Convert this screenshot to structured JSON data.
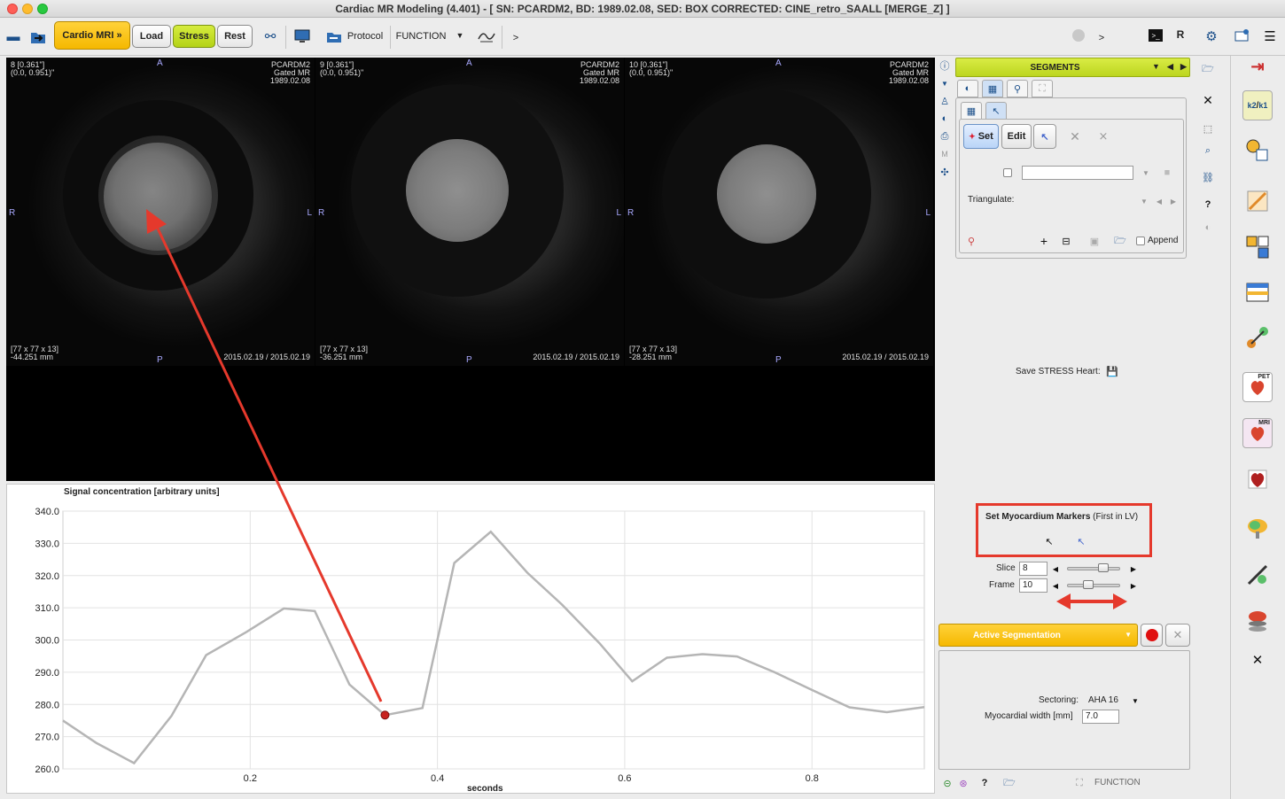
{
  "window": {
    "title": "Cardiac MR Modeling (4.401) - [ SN: PCARDM2, BD: 1989.02.08, SED: BOX CORRECTED: CINE_retro_SAALL  [MERGE_Z] ]"
  },
  "toolbar": {
    "cardio_label": "Cardio MRI »",
    "load_label": "Load",
    "stress_label": "Stress",
    "rest_label": "Rest",
    "protocol_label": "Protocol",
    "function_label": "FUNCTION",
    "more_label": ">",
    "more2_label": ">",
    "r_label": "R"
  },
  "viewports": [
    {
      "slice_info": "8 [0.361\"]\n(0.0, 0.951)\"",
      "patient_info": "PCARDM2\nGated MR\n1989.02.08",
      "dims": "[77 x 77 x 13]\n-44.251 mm",
      "dates": "2015.02.19 / 2015.02.19",
      "orient_a": "A",
      "orient_p": "P",
      "orient_r": "R",
      "orient_l": "L"
    },
    {
      "slice_info": "9 [0.361\"]\n(0.0, 0.951)\"",
      "patient_info": "PCARDM2\nGated MR\n1989.02.08",
      "dims": "[77 x 77 x 13]\n-36.251 mm",
      "dates": "2015.02.19 / 2015.02.19",
      "orient_a": "A",
      "orient_p": "P",
      "orient_r": "R",
      "orient_l": "L"
    },
    {
      "slice_info": "10 [0.361\"]\n(0.0, 0.951)\"",
      "patient_info": "PCARDM2\nGated MR\n1989.02.08",
      "dims": "[77 x 77 x 13]\n-28.251 mm",
      "dates": "2015.02.19 / 2015.02.19",
      "orient_a": "A",
      "orient_p": "P",
      "orient_r": "R",
      "orient_l": "L"
    }
  ],
  "chart_data": {
    "type": "line",
    "ylabel": "Signal concentration [arbitrary units]",
    "xlabel": "seconds",
    "ylim": [
      260.0,
      340.0
    ],
    "xlim": [
      0.0,
      0.92
    ],
    "y_ticks": [
      "340.0",
      "330.0",
      "320.0",
      "310.0",
      "300.0",
      "290.0",
      "280.0",
      "270.0",
      "260.0"
    ],
    "x_ticks": [
      "0.2",
      "0.4",
      "0.6",
      "0.8"
    ],
    "grid": true,
    "x": [
      0.0,
      0.036,
      0.076,
      0.116,
      0.153,
      0.196,
      0.236,
      0.269,
      0.306,
      0.344,
      0.384,
      0.418,
      0.457,
      0.496,
      0.533,
      0.573,
      0.608,
      0.645,
      0.683,
      0.72,
      0.76,
      0.8,
      0.84,
      0.88,
      0.92
    ],
    "y": [
      275.0,
      268.0,
      261.8,
      276.5,
      295.3,
      302.5,
      309.8,
      309.0,
      286.2,
      276.7,
      278.9,
      323.9,
      333.6,
      320.9,
      311.0,
      299.0,
      287.2,
      294.5,
      295.6,
      294.9,
      290.0,
      284.5,
      279.1,
      277.6,
      279.2
    ],
    "selected_point": {
      "x": 0.344,
      "y": 276.7
    },
    "line_color": "#b5b5b5",
    "marker_color": "#c8221f"
  },
  "segments": {
    "header_label": "SEGMENTS",
    "set_label": "Set",
    "edit_label": "Edit",
    "triangulate_label": "Triangulate:",
    "append_label": "Append",
    "save_heart_label": "Save STRESS Heart:"
  },
  "markers": {
    "title": "Set Myocardium Markers",
    "subtitle": "(First in LV)",
    "slice_label": "Slice",
    "slice_value": "8",
    "frame_label": "Frame",
    "frame_value": "10",
    "slice_level": 0.72,
    "frame_level": 0.38
  },
  "active_segmentation": {
    "label": "Active Segmentation",
    "sectoring_label": "Sectoring:",
    "sectoring_value": "AHA 16",
    "width_label": "Myocardial width [mm]",
    "width_value": "7.0"
  },
  "footer": {
    "function_label": "FUNCTION",
    "help_label": "?"
  },
  "sidebar": {
    "pet_label": "PET",
    "mri_label": "MRI",
    "k2_label": "k2",
    "k1_label": "k1"
  },
  "colors": {
    "accent_yellow": "#f5b800",
    "accent_green": "#bcd51f",
    "annotation_red": "#e5392c"
  }
}
